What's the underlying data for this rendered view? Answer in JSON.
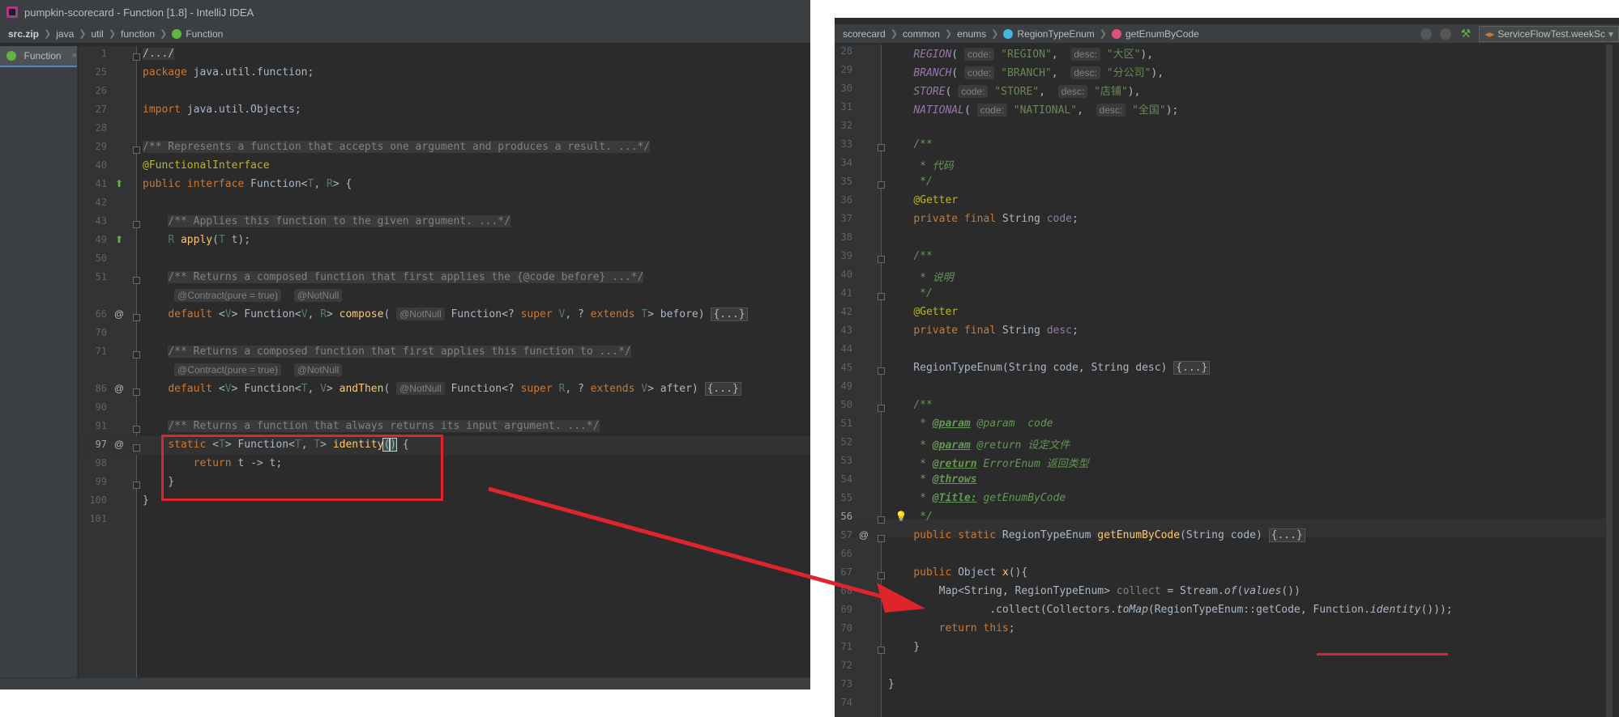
{
  "left": {
    "window_title": "pumpkin-scorecard - Function [1.8] - IntelliJ IDEA",
    "breadcrumb": [
      "src.zip",
      "java",
      "util",
      "function",
      "Function"
    ],
    "tab_label": "Function",
    "inlays": {
      "contract": "@Contract(pure = true)",
      "notnull": "@NotNull"
    },
    "line_numbers": [
      "1",
      "25",
      "26",
      "27",
      "28",
      "29",
      "40",
      "41",
      "42",
      "43",
      "49",
      "50",
      "51",
      "",
      "66",
      "70",
      "71",
      "",
      "86",
      "90",
      "91",
      "97",
      "98",
      "99",
      "100",
      "101"
    ]
  },
  "right": {
    "breadcrumb": [
      "scorecard",
      "common",
      "enums",
      "RegionTypeEnum",
      "getEnumByCode"
    ],
    "run_config": "ServiceFlowTest.weekSc",
    "param_hints": {
      "code": "code:",
      "desc": "desc:"
    },
    "line_numbers": [
      "28",
      "29",
      "30",
      "31",
      "32",
      "33",
      "34",
      "35",
      "36",
      "37",
      "38",
      "39",
      "40",
      "41",
      "42",
      "43",
      "44",
      "45",
      "49",
      "50",
      "51",
      "52",
      "53",
      "54",
      "55",
      "56",
      "57",
      "66",
      "67",
      "68",
      "69",
      "70",
      "71",
      "72",
      "73",
      "74"
    ]
  },
  "colors": {
    "editor_bg": "#2b2b2b",
    "keyword": "#cc7832",
    "string": "#6a8759",
    "annotation": "#bbb529",
    "comment": "#808080",
    "method": "#ffc66d",
    "annotation_box": "#e0242b"
  }
}
